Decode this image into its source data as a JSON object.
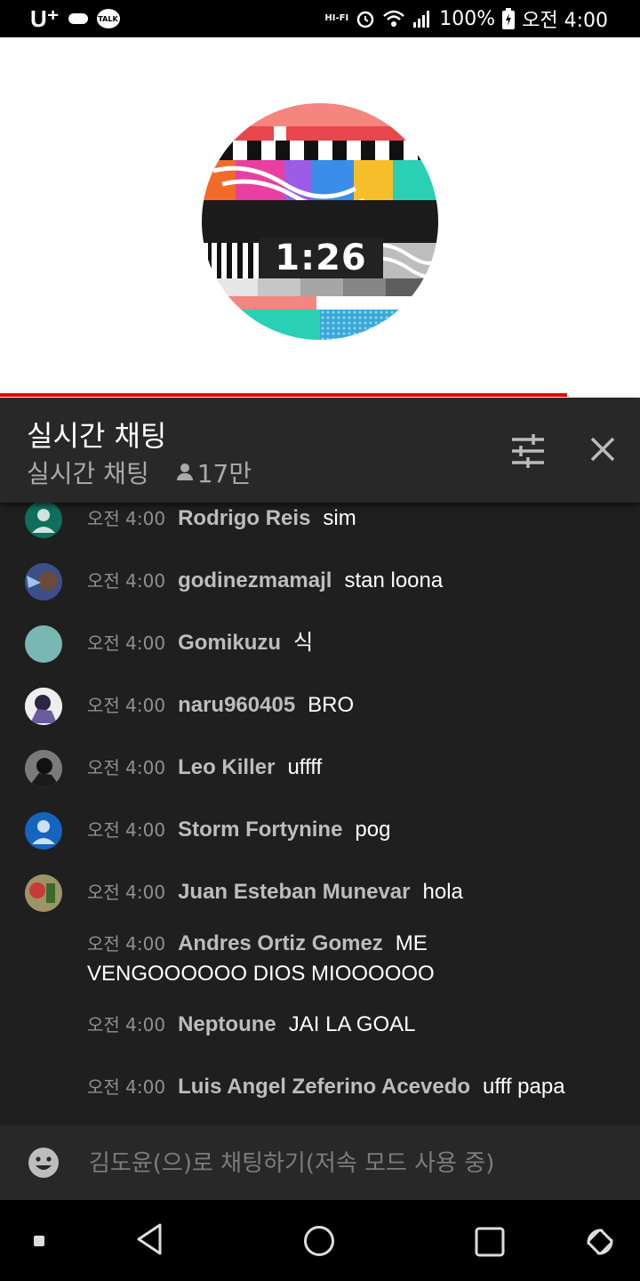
{
  "status_bar": {
    "carrier": "U⁺",
    "talk_label": "TALK",
    "hifi_top": "HI",
    "hifi_bottom": "HI-FI",
    "battery": "100%",
    "time": "오전 4:00"
  },
  "video": {
    "countdown": "1:26",
    "progress_percent": 88.6
  },
  "chat_header": {
    "title": "실시간 채팅",
    "mode": "실시간 채팅",
    "viewers": "17만"
  },
  "messages": [
    {
      "time": "오전 4:00",
      "author": "Rodrigo Reis",
      "text": "sim",
      "avatar": "default-teal"
    },
    {
      "time": "오전 4:00",
      "author": "godinezmamajl",
      "text": "stan loona",
      "avatar": "photo"
    },
    {
      "time": "오전 4:00",
      "author": "Gomikuzu",
      "text": "식",
      "avatar": "solid-teal"
    },
    {
      "time": "오전 4:00",
      "author": "naru960405",
      "text": "BRO",
      "avatar": "photo"
    },
    {
      "time": "오전 4:00",
      "author": "Leo Killer",
      "text": "uffff",
      "avatar": "photo"
    },
    {
      "time": "오전 4:00",
      "author": "Storm Fortynine",
      "text": "pog",
      "avatar": "default-blue"
    },
    {
      "time": "오전 4:00",
      "author": "Juan Esteban Munevar",
      "text": "hola",
      "avatar": "photo"
    },
    {
      "time": "오전 4:00",
      "author": "Andres Ortiz Gomez",
      "text": "ME VENGOOOOOO DIOS MIOOOOOO",
      "avatar": ""
    },
    {
      "time": "오전 4:00",
      "author": "Neptoune",
      "text": "JAI LA GOAL",
      "avatar": ""
    },
    {
      "time": "오전 4:00",
      "author": "Luis Angel  Zeferino Acevedo",
      "text": "ufff papa",
      "avatar": ""
    }
  ],
  "input": {
    "placeholder": "김도윤(으)로 채팅하기(저속 모드 사용 중)"
  },
  "colors": {
    "accent": "#e00000",
    "chat_bg": "#1f1f1f",
    "header_bg": "#282828"
  },
  "icons": [
    "emoji-icon",
    "filter-icon",
    "close-icon",
    "person-icon",
    "back-icon",
    "home-icon",
    "recents-icon",
    "rotate-icon"
  ]
}
